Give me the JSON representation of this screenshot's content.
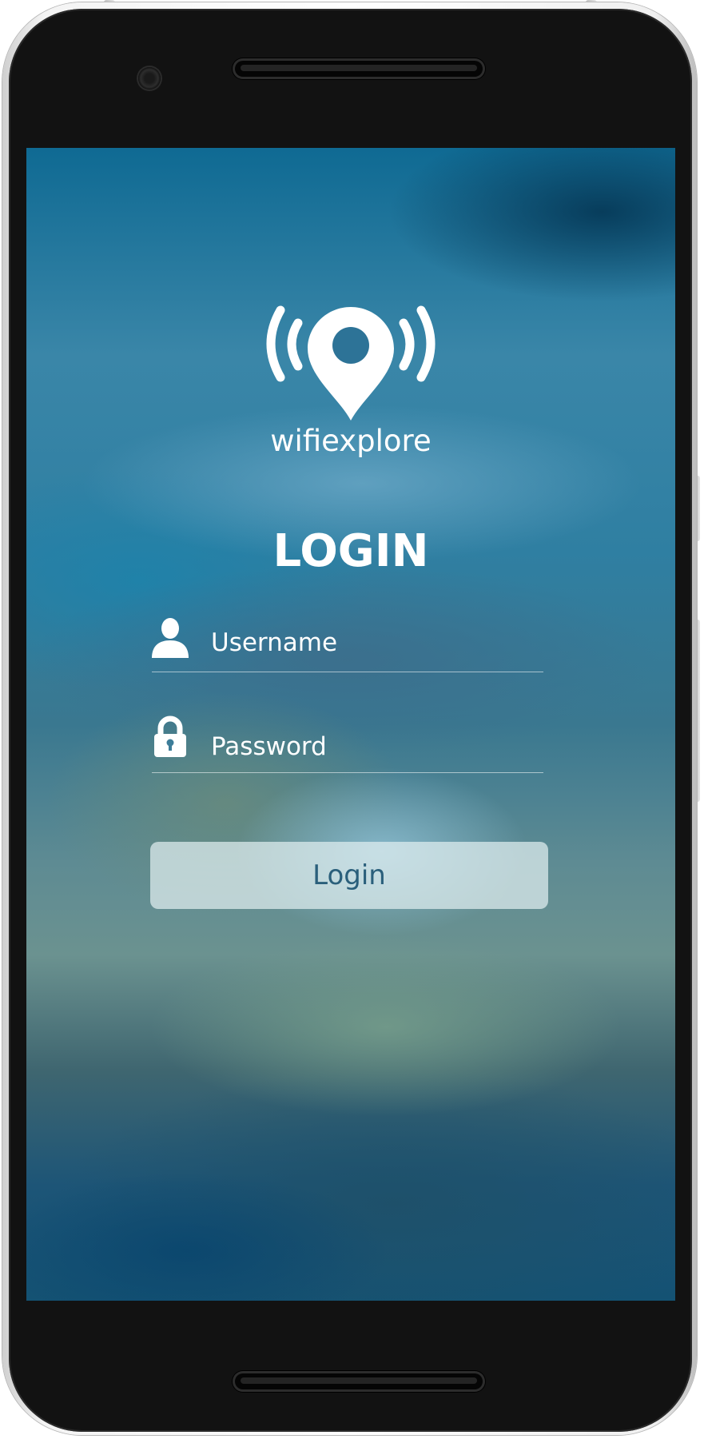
{
  "app": {
    "brand_name": "wifiexplore",
    "logo_icon": "wifi-location-pin-icon"
  },
  "login": {
    "title": "LOGIN",
    "username_placeholder": "Username",
    "username_icon": "user-icon",
    "password_placeholder": "Password",
    "password_icon": "lock-icon",
    "button_label": "Login"
  },
  "colors": {
    "text": "#ffffff",
    "button_bg": "#e1eef0",
    "button_text": "#2a5f7b",
    "bezel": "#121212"
  }
}
